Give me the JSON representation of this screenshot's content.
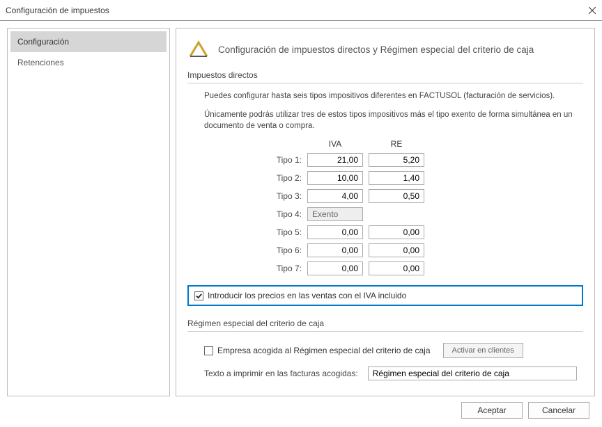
{
  "window": {
    "title": "Configuración de impuestos"
  },
  "sidebar": {
    "items": [
      {
        "label": "Configuración",
        "selected": true
      },
      {
        "label": "Retenciones",
        "selected": false
      }
    ]
  },
  "main": {
    "title": "Configuración de impuestos directos y Régimen especial del criterio de caja",
    "section_directos": {
      "heading": "Impuestos directos",
      "intro1": "Puedes configurar hasta seis tipos impositivos diferentes en FACTUSOL (facturación de servicios).",
      "intro2": "Únicamente podrás utilizar tres de estos tipos impositivos más el tipo exento de forma simultánea en un documento de venta o compra.",
      "col_iva": "IVA",
      "col_re": "RE",
      "rows": [
        {
          "label": "Tipo 1:",
          "iva": "21,00",
          "re": "5,20"
        },
        {
          "label": "Tipo 2:",
          "iva": "10,00",
          "re": "1,40"
        },
        {
          "label": "Tipo 3:",
          "iva": "4,00",
          "re": "0,50"
        },
        {
          "label": "Tipo 4:",
          "iva": "Exento",
          "re": "",
          "disabled": true
        },
        {
          "label": "Tipo 5:",
          "iva": "0,00",
          "re": "0,00"
        },
        {
          "label": "Tipo 6:",
          "iva": "0,00",
          "re": "0,00"
        },
        {
          "label": "Tipo 7:",
          "iva": "0,00",
          "re": "0,00"
        }
      ],
      "iva_included_checked": true,
      "iva_included_label": "Introducir los precios en las ventas con el IVA incluido"
    },
    "section_regimen": {
      "heading": "Régimen especial del criterio de caja",
      "acogida_checked": false,
      "acogida_label": "Empresa acogida al Régimen especial del criterio de caja",
      "activar_label": "Activar en clientes",
      "texto_label": "Texto a imprimir en las facturas acogidas:",
      "texto_value": "Régimen especial del criterio de caja"
    }
  },
  "footer": {
    "accept": "Aceptar",
    "cancel": "Cancelar"
  }
}
